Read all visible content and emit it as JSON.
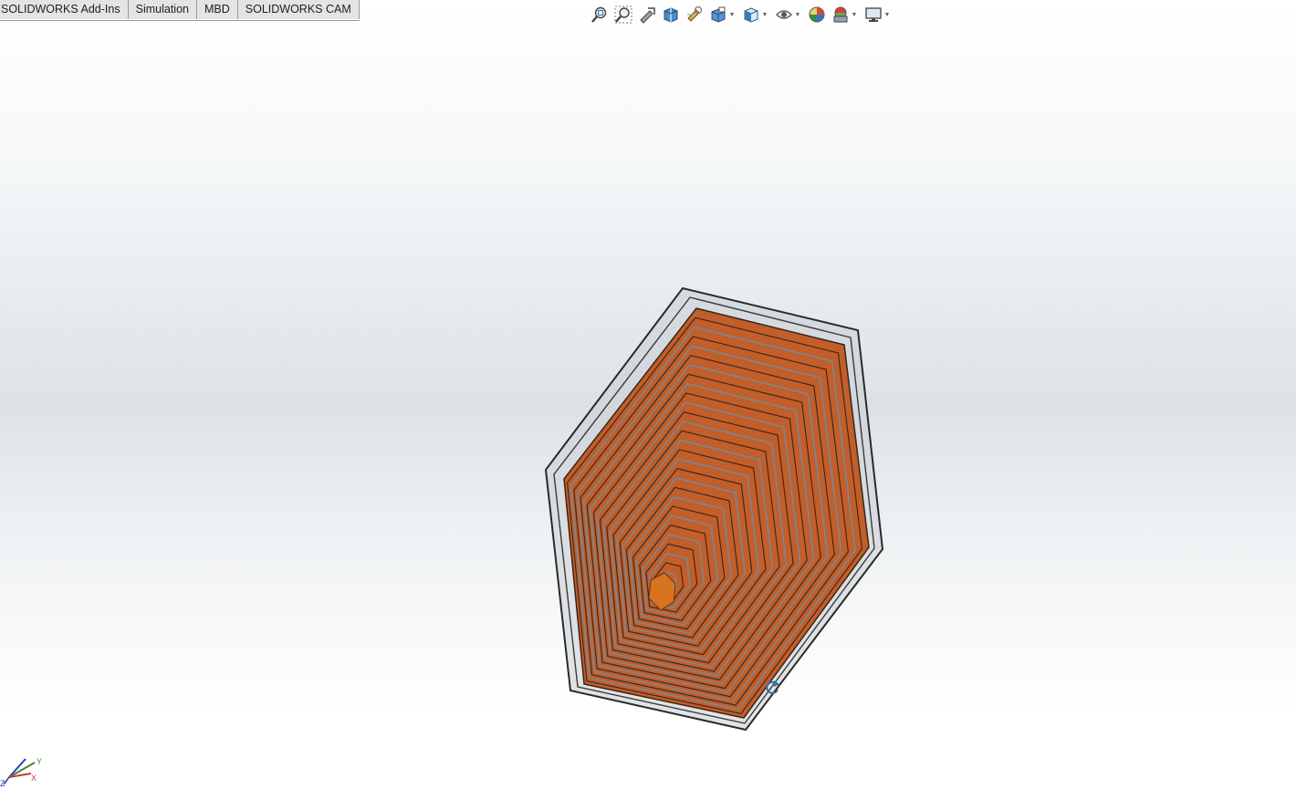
{
  "command_manager": {
    "tabs": [
      {
        "label": "SOLIDWORKS Add-Ins"
      },
      {
        "label": "Simulation"
      },
      {
        "label": "MBD"
      },
      {
        "label": "SOLIDWORKS CAM"
      }
    ]
  },
  "heads_up_toolbar": {
    "tools": [
      "zoom-to-fit-icon",
      "zoom-to-area-icon",
      "previous-view-icon",
      "section-view-icon",
      "dynamic-annotation-views-icon",
      "view-orientation-icon",
      "display-style-icon",
      "hide-show-items-icon",
      "edit-appearance-icon",
      "apply-scene-icon",
      "view-settings-icon"
    ]
  },
  "model": {
    "body_color": "#c25e2a",
    "core_color": "#d9741e",
    "frame_color": "#b9c0c7"
  },
  "triad": {
    "x_label": "X",
    "y_label": "Y",
    "z_label": "Z"
  }
}
